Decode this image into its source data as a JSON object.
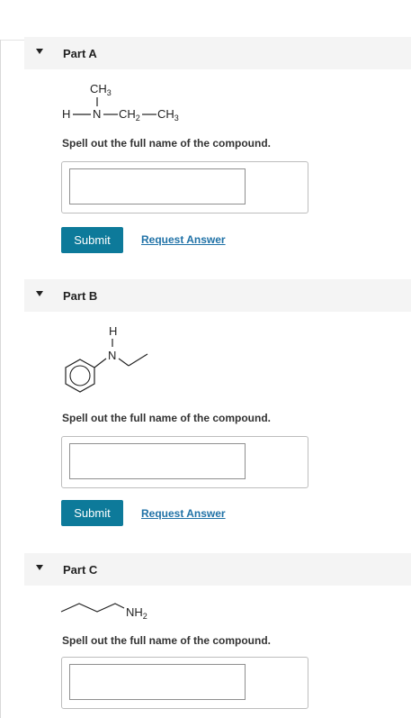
{
  "parts": [
    {
      "title": "Part A",
      "formula": {
        "ch3_top": "CH3",
        "h": "H",
        "n": "N",
        "ch2": "CH2",
        "ch3_right": "CH3"
      },
      "prompt": "Spell out the full name of the compound.",
      "submit_label": "Submit",
      "request_label": "Request Answer",
      "answer_value": ""
    },
    {
      "title": "Part B",
      "atoms": {
        "h": "H",
        "n": "N"
      },
      "prompt": "Spell out the full name of the compound.",
      "submit_label": "Submit",
      "request_label": "Request Answer",
      "answer_value": ""
    },
    {
      "title": "Part C",
      "atoms": {
        "nh2": "NH2"
      },
      "prompt": "Spell out the full name of the compound.",
      "answer_value": ""
    }
  ],
  "colors": {
    "submit_bg": "#0d7a9a",
    "link": "#2072a7",
    "header_bg": "#f4f4f4"
  },
  "icons": {
    "collapse": "caret-down-icon"
  }
}
